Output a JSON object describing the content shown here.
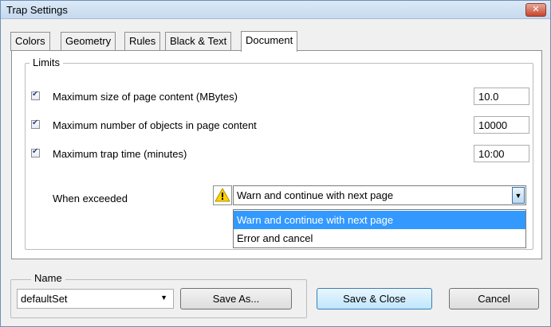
{
  "window": {
    "title": "Trap Settings",
    "close_label": "✕"
  },
  "tabs": [
    "Colors",
    "Geometry",
    "Rules",
    "Black & Text",
    "Document"
  ],
  "limits": {
    "group_label": "Limits",
    "rows": [
      {
        "label": "Maximum size of page content (MBytes)",
        "value": "10.0",
        "checked": true
      },
      {
        "label": "Maximum number of objects in page content",
        "value": "10000",
        "checked": true
      },
      {
        "label": "Maximum trap time (minutes)",
        "value": "10:00",
        "checked": true
      }
    ],
    "when_exceeded_label": "When exceeded",
    "when_exceeded_value": "Warn and continue with next page",
    "options": [
      "Warn and continue with next page",
      "Error and cancel"
    ]
  },
  "name_group": {
    "label": "Name",
    "value": "defaultSet",
    "save_as": "Save As..."
  },
  "buttons": {
    "save_close": "Save & Close",
    "cancel": "Cancel"
  },
  "icons": {
    "warning": "warning-icon",
    "accent": "#3399ff"
  }
}
